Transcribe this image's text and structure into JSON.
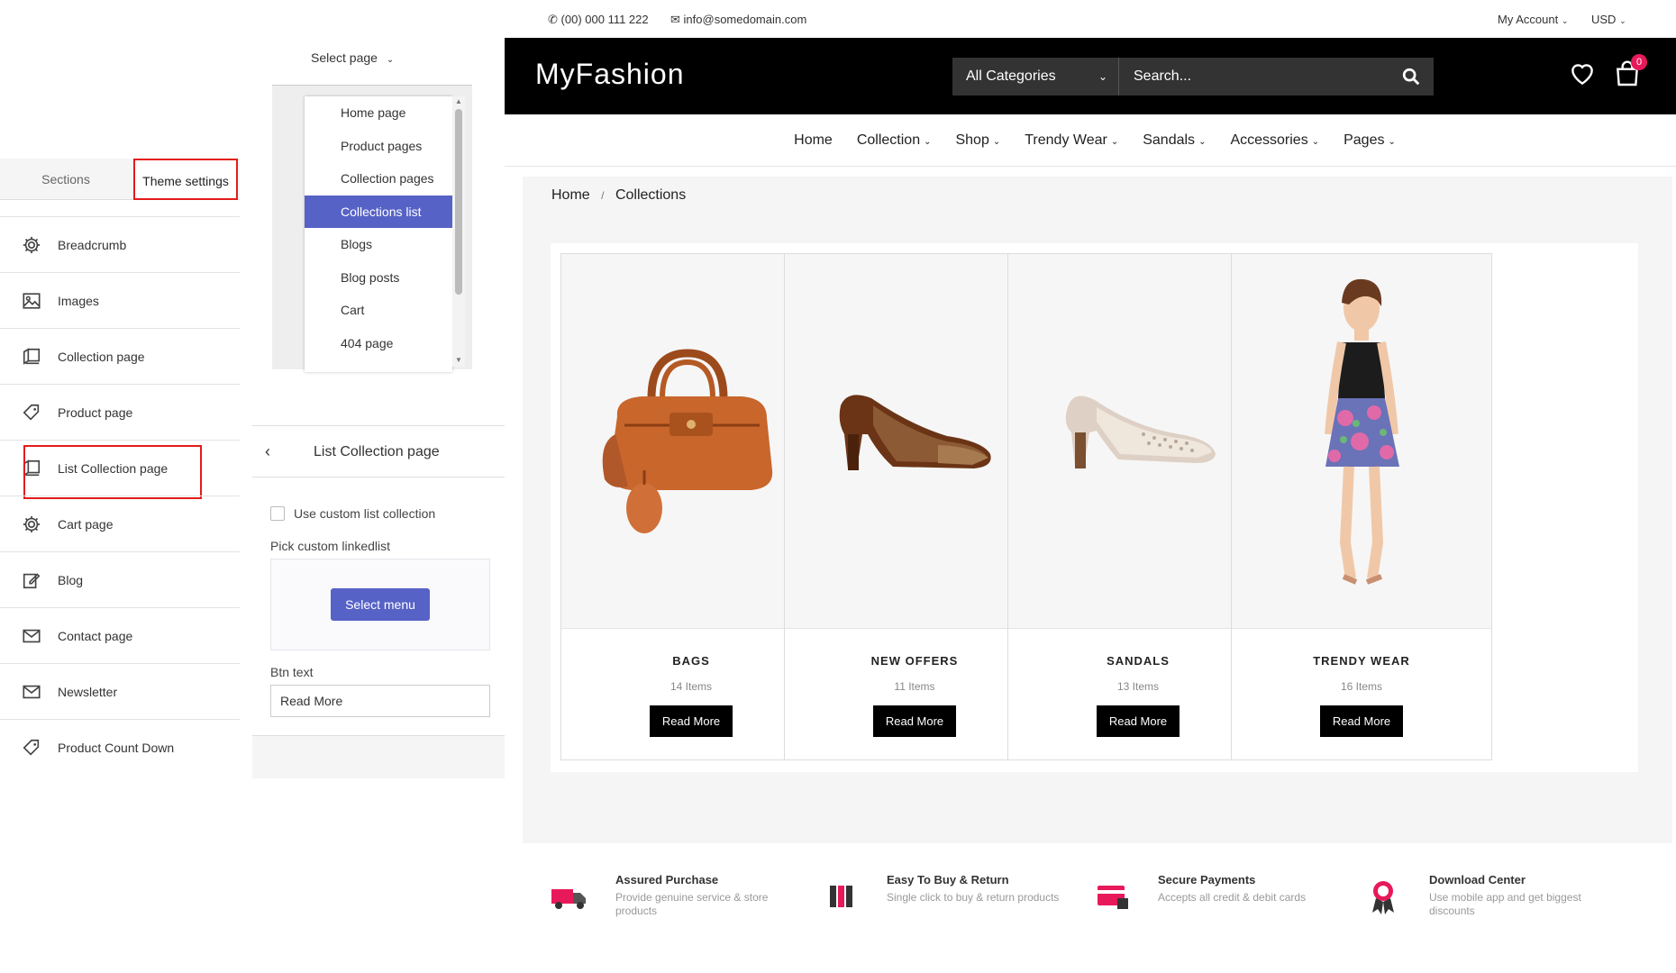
{
  "sidebar": {
    "tabs": [
      "Sections",
      "Theme settings"
    ],
    "items": [
      {
        "label": "Breadcrumb",
        "icon": "gear-icon"
      },
      {
        "label": "Images",
        "icon": "image-icon"
      },
      {
        "label": "Collection page",
        "icon": "book-icon"
      },
      {
        "label": "Product page",
        "icon": "tag-icon"
      },
      {
        "label": "List Collection page",
        "icon": "book-icon"
      },
      {
        "label": "Cart page",
        "icon": "gear-icon"
      },
      {
        "label": "Blog",
        "icon": "edit-icon"
      },
      {
        "label": "Contact page",
        "icon": "mail-icon"
      },
      {
        "label": "Newsletter",
        "icon": "mail-icon"
      },
      {
        "label": "Product Count Down",
        "icon": "tag-icon"
      }
    ]
  },
  "page_select": {
    "label": "Select page",
    "options": [
      "Home page",
      "Product pages",
      "Collection pages",
      "Collections list",
      "Blogs",
      "Blog posts",
      "Cart",
      "404 page"
    ],
    "selected": "Collections list"
  },
  "panel": {
    "title": "List Collection page",
    "checkbox_label": "Use custom list collection",
    "pick_label": "Pick custom linkedlist",
    "select_menu": "Select menu",
    "btn_text_label": "Btn text",
    "btn_text_value": "Read More"
  },
  "store": {
    "phone": "(00) 000 111 222",
    "email": "info@somedomain.com",
    "account": "My Account",
    "currency": "USD",
    "logo": "MyFashion",
    "category_select": "All Categories",
    "search_placeholder": "Search...",
    "cart_count": "0",
    "nav": [
      {
        "label": "Home",
        "dropdown": false
      },
      {
        "label": "Collection",
        "dropdown": true
      },
      {
        "label": "Shop",
        "dropdown": true
      },
      {
        "label": "Trendy Wear",
        "dropdown": true
      },
      {
        "label": "Sandals",
        "dropdown": true
      },
      {
        "label": "Accessories",
        "dropdown": true
      },
      {
        "label": "Pages",
        "dropdown": true
      }
    ],
    "breadcrumb": [
      "Home",
      "Collections"
    ],
    "collections": [
      {
        "title": "BAGS",
        "count": "14 Items",
        "button": "Read More",
        "image": "handbag"
      },
      {
        "title": "NEW OFFERS",
        "count": "11 Items",
        "button": "Read More",
        "image": "heel-shoe"
      },
      {
        "title": "SANDALS",
        "count": "13 Items",
        "button": "Read More",
        "image": "pump-shoe"
      },
      {
        "title": "TRENDY WEAR",
        "count": "16 Items",
        "button": "Read More",
        "image": "model-dress"
      }
    ],
    "features": [
      {
        "title": "Assured Purchase",
        "desc": "Provide genuine service & store products",
        "icon": "truck-icon"
      },
      {
        "title": "Easy To Buy & Return",
        "desc": "Single click to buy & return products",
        "icon": "return-icon"
      },
      {
        "title": "Secure Payments",
        "desc": "Accepts all credit & debit cards",
        "icon": "card-icon"
      },
      {
        "title": "Download Center",
        "desc": "Use mobile app and get biggest discounts",
        "icon": "badge-icon"
      }
    ]
  },
  "colors": {
    "accent": "#5762c6",
    "highlight": "#e41b1b",
    "brand_pink": "#e8195b",
    "header_bg": "#000000"
  }
}
